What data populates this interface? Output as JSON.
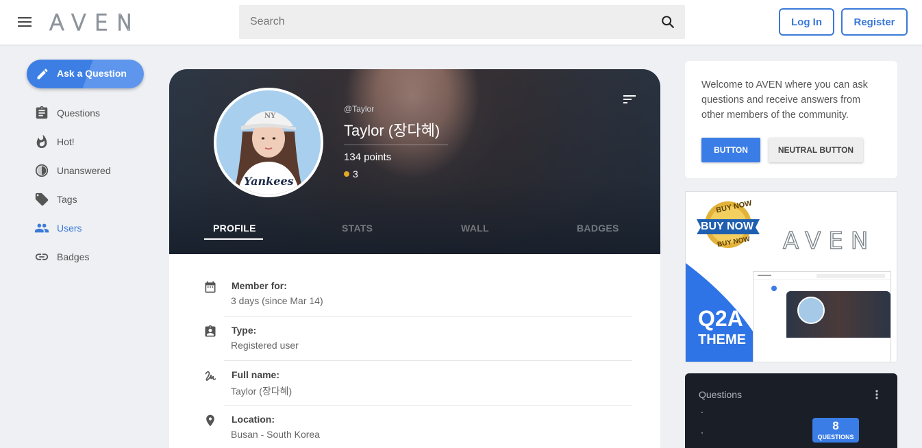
{
  "header": {
    "logo": "AVEN",
    "search_placeholder": "Search",
    "login_label": "Log In",
    "register_label": "Register"
  },
  "sidebar": {
    "ask_label": "Ask a Question",
    "items": [
      {
        "label": "Questions",
        "icon": "clipboard-icon"
      },
      {
        "label": "Hot!",
        "icon": "fire-icon"
      },
      {
        "label": "Unanswered",
        "icon": "half-circle-icon"
      },
      {
        "label": "Tags",
        "icon": "tag-icon"
      },
      {
        "label": "Users",
        "icon": "people-icon",
        "active": true
      },
      {
        "label": "Badges",
        "icon": "link-icon"
      }
    ]
  },
  "profile": {
    "handle": "@Taylor",
    "name": "Taylor (장다혜)",
    "points": "134 points",
    "medals": "3",
    "tabs": [
      "PROFILE",
      "STATS",
      "WALL",
      "BADGES"
    ],
    "active_tab": "PROFILE",
    "fields": [
      {
        "label": "Member for:",
        "value": "3 days (since Mar 14)",
        "icon": "calendar-icon"
      },
      {
        "label": "Type:",
        "value": "Registered user",
        "icon": "badge-icon"
      },
      {
        "label": "Full name:",
        "value": "Taylor (장다혜)",
        "icon": "signature-icon"
      },
      {
        "label": "Location:",
        "value": "Busan - South Korea",
        "icon": "location-pin-icon"
      }
    ]
  },
  "welcome": {
    "text": "Welcome to AVEN where you can ask questions and receive answers from other members of the community.",
    "button_label": "BUTTON",
    "neutral_button_label": "NEUTRAL BUTTON"
  },
  "ad": {
    "seal_top": "BUY NOW",
    "seal_main": "BUY NOW",
    "seal_bottom": "BUY NOW",
    "logo": "AVEN",
    "title": "Q2A",
    "subtitle": "THEME"
  },
  "questions_widget": {
    "title": "Questions",
    "count": "8",
    "count_label": "QUESTIONS"
  },
  "colors": {
    "accent": "#3b79d9",
    "medal": "#e3a72a",
    "widget_bg": "#1a1f27"
  }
}
